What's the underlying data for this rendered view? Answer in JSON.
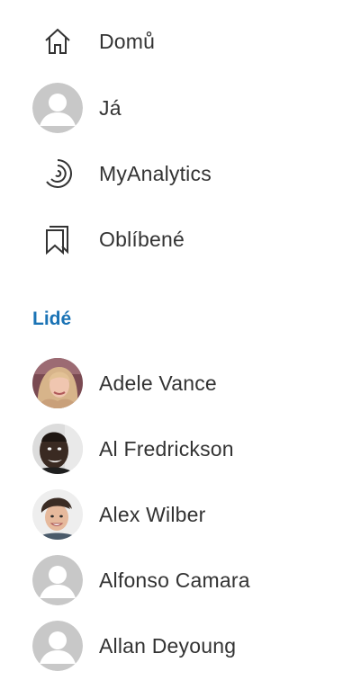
{
  "nav": {
    "items": [
      {
        "label": "Domů",
        "icon": "home-icon"
      },
      {
        "label": "Já",
        "icon": "person-avatar-icon"
      },
      {
        "label": "MyAnalytics",
        "icon": "analytics-icon"
      },
      {
        "label": "Oblíbené",
        "icon": "bookmarks-icon"
      }
    ]
  },
  "people": {
    "heading": "Lidé",
    "items": [
      {
        "name": "Adele Vance",
        "avatar": "photo"
      },
      {
        "name": "Al Fredrickson",
        "avatar": "photo"
      },
      {
        "name": "Alex Wilber",
        "avatar": "photo"
      },
      {
        "name": "Alfonso Camara",
        "avatar": "placeholder"
      },
      {
        "name": "Allan Deyoung",
        "avatar": "placeholder"
      }
    ]
  },
  "colors": {
    "heading_accent": "#1a73b5",
    "text": "#333333",
    "placeholder_avatar": "#c8c8c8"
  }
}
